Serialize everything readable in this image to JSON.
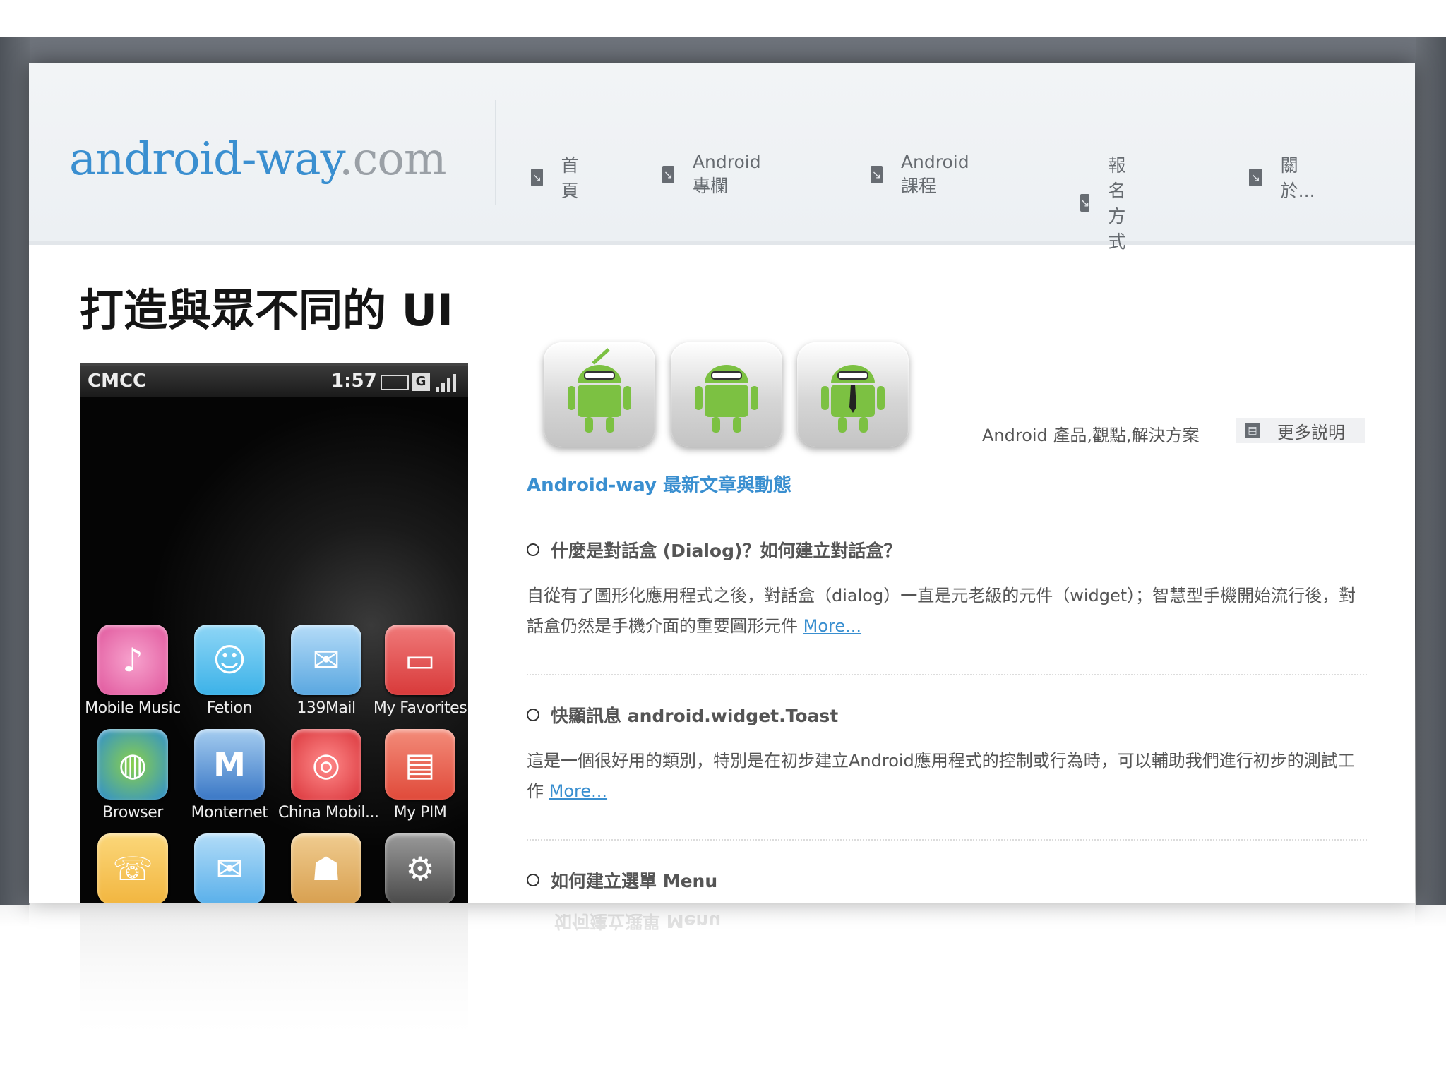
{
  "site": {
    "logo_main": "android-way",
    "logo_tld": ".com"
  },
  "nav": [
    {
      "label": "首頁"
    },
    {
      "label": "Android 專欄"
    },
    {
      "label": "Android 課程"
    },
    {
      "label": "報名方式"
    },
    {
      "label": "關於..."
    }
  ],
  "headline": "打造與眾不同的 UI",
  "phone": {
    "carrier": "CMCC",
    "time": "1:57",
    "network": "G",
    "apps": [
      {
        "label": "Mobile Music",
        "icon": "music-icon",
        "color": "#e0569c"
      },
      {
        "label": "Fetion",
        "icon": "chat-icon",
        "color": "#3cb2e8"
      },
      {
        "label": "139Mail",
        "icon": "mail-envelope-icon",
        "color": "#5aa7e0"
      },
      {
        "label": "My Favorites",
        "icon": "bookmark-icon",
        "color": "#d83a3a"
      },
      {
        "label": "Browser",
        "icon": "globe-icon",
        "color": "#2e8ed0"
      },
      {
        "label": "Monternet",
        "icon": "monternet-icon",
        "color": "#3b78c6"
      },
      {
        "label": "China Mobil...",
        "icon": "china-mobile-icon",
        "color": "#d9343a"
      },
      {
        "label": "My PIM",
        "icon": "pim-icon",
        "color": "#e04a3a"
      },
      {
        "label": "",
        "icon": "phone-icon",
        "color": "#f2b640"
      },
      {
        "label": "",
        "icon": "email-icon",
        "color": "#5ab0ea"
      },
      {
        "label": "",
        "icon": "contacts-icon",
        "color": "#d8a050"
      },
      {
        "label": "",
        "icon": "settings-gear-icon",
        "color": "#6a6a6a"
      }
    ]
  },
  "tagline": "Android 產品,觀點,解決方案",
  "more_info_label": "更多説明",
  "news_heading": "Android-way 最新文章與動態",
  "articles": [
    {
      "title": "什麼是對話盒 (Dialog)？如何建立對話盒？",
      "body": "自從有了圖形化應用程式之後，對話盒（dialog）一直是元老級的元件（widget）；智慧型手機開始流行後，對話盒仍然是手機介面的重要圖形元件",
      "more": "More..."
    },
    {
      "title": "快顯訊息 android.widget.Toast",
      "body": "這是一個很好用的類別，特別是在初步建立Android應用程式的控制或行為時，可以輔助我們進行初步的測試工作",
      "more": "More..."
    },
    {
      "title": "如何建立選單 Menu",
      "body": "",
      "more": ""
    }
  ],
  "colors": {
    "brand_blue": "#3a8fd0",
    "android_green": "#7cc142"
  }
}
